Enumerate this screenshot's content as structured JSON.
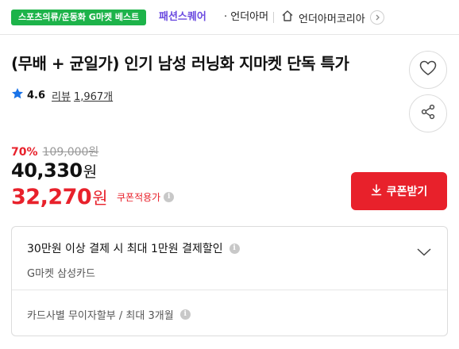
{
  "topbar": {
    "category_badge": "스포츠의류/운동화 G마켓 베스트",
    "fashion_square": "패션스퀘어",
    "brand": "· 언더아머",
    "store_name": "언더아머코리아"
  },
  "product": {
    "title": "(무배 + 균일가) 인기 남성 러닝화 지마켓 단독 특가"
  },
  "rating": {
    "score": "4.6",
    "review_label": "리뷰",
    "review_count": "1,967개"
  },
  "price": {
    "discount_rate": "70%",
    "original_price": "109,000원",
    "sale_price": "40,330",
    "sale_unit": "원",
    "coupon_price": "32,270",
    "coupon_unit": "원",
    "coupon_label": "쿠폰적용가"
  },
  "coupon_button": {
    "label": "쿠폰받기"
  },
  "card_discount": {
    "title": "30만원 이상 결제 시 최대 1만원 결제할인",
    "card_name": "G마켓 삼성카드",
    "installment": "카드사별 무이자할부 / 최대 3개월"
  },
  "colors": {
    "accent_red": "#e8212b",
    "badge_green": "#1db34a",
    "fashion_purple": "#6b4be0",
    "star_blue": "#1a73e8"
  },
  "icons": [
    "home-icon",
    "chevron-right-icon",
    "heart-icon",
    "share-icon",
    "star-icon",
    "info-icon",
    "download-icon",
    "chevron-down-icon"
  ]
}
